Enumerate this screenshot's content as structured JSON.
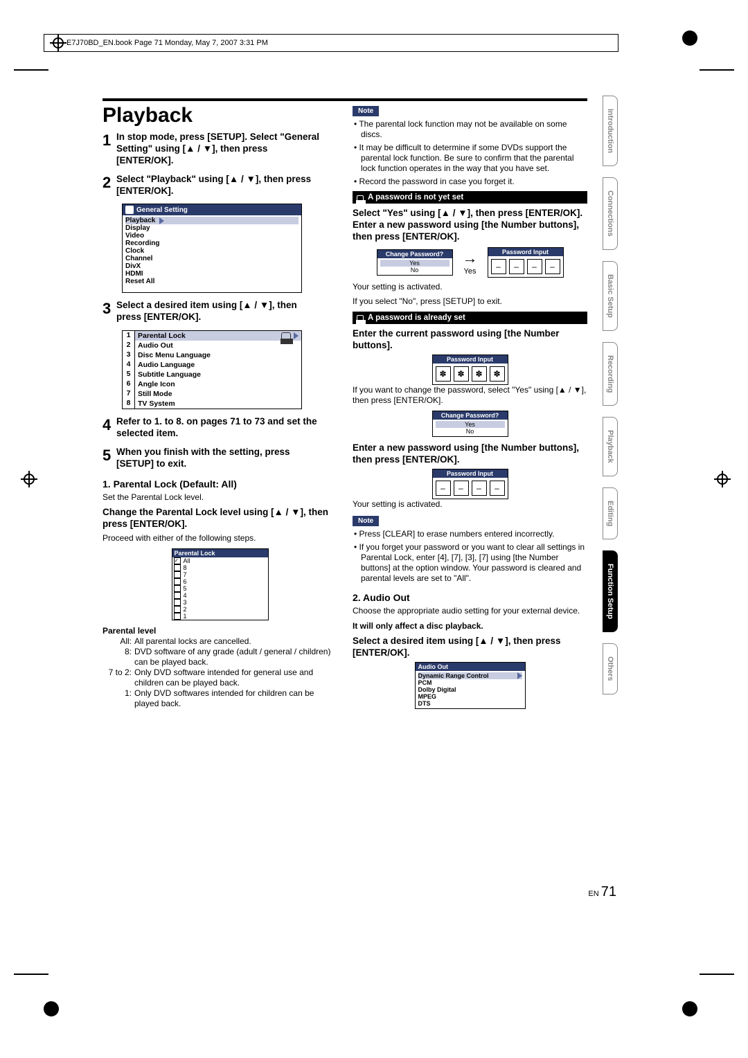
{
  "header_line": "E7J70BD_EN.book  Page 71  Monday, May 7, 2007  3:31 PM",
  "title": "Playback",
  "steps": {
    "s1": "In stop mode, press [SETUP]. Select \"General Setting\" using [▲ / ▼], then press [ENTER/OK].",
    "s2": "Select \"Playback\" using [▲ / ▼], then press [ENTER/OK].",
    "s3": "Select a desired item using [▲ / ▼], then press [ENTER/OK].",
    "s4": "Refer to 1. to 8. on pages 71 to 73 and set the selected item.",
    "s5": "When you finish with the setting, press [SETUP] to exit."
  },
  "menu1": {
    "title": "General Setting",
    "items": [
      "Playback",
      "Display",
      "Video",
      "Recording",
      "Clock",
      "Channel",
      "DivX",
      "HDMI",
      "Reset All"
    ]
  },
  "menu2": {
    "items": [
      "Parental Lock",
      "Audio Out",
      "Disc Menu Language",
      "Audio Language",
      "Subtitle Language",
      "Angle Icon",
      "Still Mode",
      "TV System"
    ]
  },
  "parental": {
    "heading": "1. Parental Lock (Default: All)",
    "desc": "Set the Parental Lock level.",
    "instruct": "Change the Parental Lock level using [▲ / ▼], then press [ENTER/OK].",
    "proceed": "Proceed with either of the following steps.",
    "box_title": "Parental Lock",
    "levels": [
      "All",
      "8",
      "7",
      "6",
      "5",
      "4",
      "3",
      "2",
      "1"
    ],
    "def_title": "Parental level",
    "def_all": "All parental locks are cancelled.",
    "def_8": "DVD software of any grade (adult / general / children) can be played back.",
    "def_7_2": "Only DVD software intended for general use and children can be played back.",
    "def_1": "Only DVD softwares intended for children can be played back."
  },
  "right": {
    "note1a": "The parental lock function may not be available on some discs.",
    "note1b": "It may be difficult to determine if some DVDs support the parental lock function. Be sure to confirm that the parental lock function operates in the way that you have set.",
    "note1c": "Record the password in case you forget it.",
    "bar_notset": "A password is not yet set",
    "notset_text": "Select \"Yes\" using [▲ / ▼], then press [ENTER/OK]. Enter a new password using [the Number buttons], then press [ENTER/OK].",
    "cp_title": "Change Password?",
    "yes": "Yes",
    "no": "No",
    "pw_title": "Password Input",
    "yes_label": "Yes",
    "activated": "Your setting is activated.",
    "ifno": "If you select \"No\", press [SETUP] to exit.",
    "bar_set": "A password is already set",
    "set_text1": "Enter the current password using [the Number buttons].",
    "ast": "✽",
    "ifchange": "If you want to change the password, select \"Yes\" using [▲ / ▼], then press [ENTER/OK].",
    "set_text2": "Enter a new password using [the Number buttons], then press [ENTER/OK].",
    "note2a": "Press [CLEAR] to erase numbers entered incorrectly.",
    "note2b": "If you forget your password or you want to clear all settings in Parental Lock, enter [4], [7], [3], [7] using [the Number buttons] at the option window. Your password is cleared and parental levels are set to \"All\".",
    "audio_heading": "2. Audio Out",
    "audio_desc": "Choose the appropriate audio setting for your external device.",
    "audio_bold": "It will only affect a disc playback.",
    "audio_instruct": "Select a desired item using [▲ / ▼], then press [ENTER/OK].",
    "audio_box_title": "Audio Out",
    "audio_items": [
      "Dynamic Range Control",
      "PCM",
      "Dolby Digital",
      "MPEG",
      "DTS"
    ]
  },
  "tabs": [
    "Introduction",
    "Connections",
    "Basic Setup",
    "Recording",
    "Playback",
    "Editing",
    "Function Setup",
    "Others"
  ],
  "page_label": "EN",
  "page_num": "71"
}
